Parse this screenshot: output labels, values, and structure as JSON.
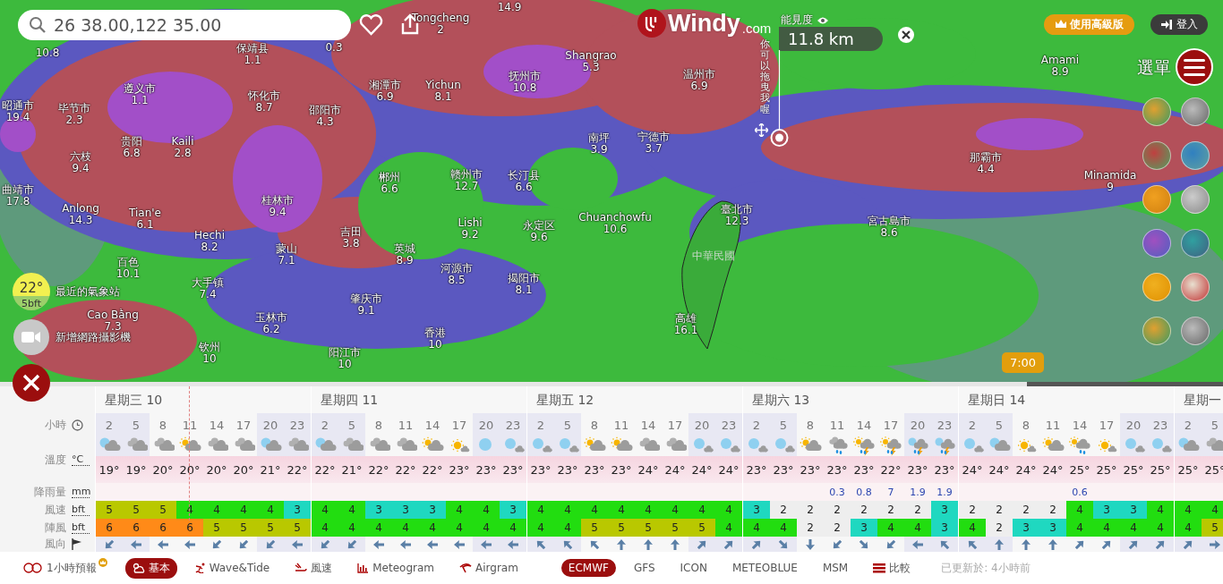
{
  "search": {
    "value": "26 38.00,122 35.00"
  },
  "logo": {
    "name": "Windy",
    "suffix": ".com"
  },
  "visibility": {
    "label": "能見度",
    "value": "11.8 km",
    "hint": "你可以拖曳我喔"
  },
  "premium_button": "使用高級版",
  "login_button": "登入",
  "menu_label": "選單",
  "station": {
    "temp": "22°",
    "wind": "5bft",
    "label": "最近的氣象站"
  },
  "webcam_label": "新增網路攝影機",
  "timeline": {
    "time": "7:00",
    "level": 0.84
  },
  "map_labels": [
    {
      "value": "10.8"
    },
    {
      "name": "保靖县",
      "value": "1.1"
    },
    {
      "value": "0.3"
    },
    {
      "name": "Tongcheng",
      "value": "2"
    },
    {
      "value": "14.9"
    },
    {
      "name": "遵义市",
      "value": "1.1"
    },
    {
      "name": "怀化市",
      "value": "8.7"
    },
    {
      "name": "湘潭市",
      "value": "6.9"
    },
    {
      "name": "Yichun",
      "value": "8.1"
    },
    {
      "name": "抚州市",
      "value": "10.8"
    },
    {
      "name": "Shangrao",
      "value": "5.3"
    },
    {
      "name": "温州市",
      "value": "6.9"
    },
    {
      "name": "昭通市",
      "value": "19.4"
    },
    {
      "name": "毕节市",
      "value": "2.3"
    },
    {
      "name": "邵阳市",
      "value": "4.3"
    },
    {
      "name": "贵阳",
      "value": "6.8"
    },
    {
      "name": "Kaili",
      "value": "2.8"
    },
    {
      "name": "六枝",
      "value": "9.4"
    },
    {
      "name": "南坪",
      "value": "3.9"
    },
    {
      "name": "宁德市",
      "value": "3.7"
    },
    {
      "name": "曲靖市",
      "value": "17.8"
    },
    {
      "name": "郴州",
      "value": "6.6"
    },
    {
      "name": "赣州市",
      "value": "12.7"
    },
    {
      "name": "长汀县",
      "value": "6.6"
    },
    {
      "name": "桂林市",
      "value": "9.4"
    },
    {
      "name": "Anlong",
      "value": "14.3"
    },
    {
      "name": "Tian'e",
      "value": "6.1"
    },
    {
      "name": "Lishi",
      "value": "9.2"
    },
    {
      "name": "永定区",
      "value": "9.6"
    },
    {
      "name": "Chuanchowfu",
      "value": "10.6"
    },
    {
      "name": "臺北市",
      "value": "12.3"
    },
    {
      "name": "宮古島市",
      "value": "8.6"
    },
    {
      "name": "那霸市",
      "value": "4.4"
    },
    {
      "name": "Amami",
      "value": "8.9"
    },
    {
      "name": "Minamida",
      "value": "9"
    },
    {
      "name": "Hechi",
      "value": "8.2"
    },
    {
      "name": "吉田",
      "value": "3.8"
    },
    {
      "name": "蒙山",
      "value": "7.1"
    },
    {
      "name": "英城",
      "value": "8.9"
    },
    {
      "name": "百色",
      "value": "10.1"
    },
    {
      "name": "河源市",
      "value": "8.5"
    },
    {
      "name": "揭阳市",
      "value": "8.1"
    },
    {
      "name": "大手镇",
      "value": "7.4"
    },
    {
      "name": "肇庆市",
      "value": "9.1"
    },
    {
      "name": "Cao Bằng",
      "value": "7.3"
    },
    {
      "name": "玉林市",
      "value": "6.2"
    },
    {
      "name": "香港",
      "value": "10"
    },
    {
      "name": "钦州",
      "value": "10"
    },
    {
      "name": "阳江市",
      "value": "10"
    },
    {
      "name": "高雄",
      "value": "16.1"
    },
    {
      "name": "中華民國",
      "kind": "country"
    }
  ],
  "forecast": {
    "row_labels": [
      {
        "label": "小時",
        "kind": "clock"
      },
      {
        "label": "溫度",
        "kind": "unit",
        "unit": "°C"
      },
      {
        "label": "降雨量",
        "kind": "unit",
        "unit": "mm"
      },
      {
        "label": "風速",
        "kind": "unit",
        "unit": "bft"
      },
      {
        "label": "陣風",
        "kind": "unit",
        "unit": "bft"
      },
      {
        "label": "風向",
        "kind": "flag"
      }
    ],
    "days": [
      {
        "label": "星期三 10",
        "hours": [
          {
            "hour": "2",
            "night": true,
            "kind": "night-cloudy",
            "temp": "19°",
            "wind": "5",
            "gust": "6",
            "arrow": {
              "kind": "SW"
            }
          },
          {
            "hour": "5",
            "night": true,
            "kind": "cloudy",
            "temp": "19°",
            "wind": "5",
            "gust": "6",
            "arrow": {
              "kind": "W"
            }
          },
          {
            "hour": "8",
            "night": false,
            "kind": "cloudy",
            "temp": "20°",
            "wind": "5",
            "gust": "6",
            "arrow": {
              "kind": "W"
            }
          },
          {
            "hour": "11",
            "night": false,
            "kind": "sun-cloudy",
            "temp": "20°",
            "wind": "4",
            "gust": "6",
            "arrow": {
              "kind": "W"
            }
          },
          {
            "hour": "14",
            "night": false,
            "kind": "cloudy",
            "temp": "20°",
            "wind": "4",
            "gust": "5",
            "arrow": {
              "kind": "SW"
            }
          },
          {
            "hour": "17",
            "night": false,
            "kind": "cloudy",
            "temp": "20°",
            "wind": "4",
            "gust": "5",
            "arrow": {
              "kind": "SW"
            }
          },
          {
            "hour": "20",
            "night": true,
            "kind": "night-cloudy",
            "temp": "21°",
            "wind": "4",
            "gust": "5",
            "arrow": {
              "kind": "SW"
            }
          },
          {
            "hour": "23",
            "night": true,
            "kind": "cloudy",
            "temp": "22°",
            "wind": "3",
            "gust": "5",
            "arrow": {
              "kind": "W"
            }
          }
        ]
      },
      {
        "label": "星期四 11",
        "hours": [
          {
            "hour": "2",
            "night": true,
            "kind": "night-cloudy",
            "temp": "22°",
            "wind": "4",
            "gust": "4",
            "arrow": {
              "kind": "SW"
            }
          },
          {
            "hour": "5",
            "night": true,
            "kind": "cloudy",
            "temp": "21°",
            "wind": "4",
            "gust": "4",
            "arrow": {
              "kind": "SW"
            }
          },
          {
            "hour": "8",
            "night": false,
            "kind": "cloudy",
            "temp": "22°",
            "wind": "3",
            "gust": "4",
            "arrow": {
              "kind": "W"
            }
          },
          {
            "hour": "11",
            "night": false,
            "kind": "cloudy",
            "temp": "22°",
            "wind": "3",
            "gust": "4",
            "arrow": {
              "kind": "W"
            }
          },
          {
            "hour": "14",
            "night": false,
            "kind": "sun-cloudy",
            "temp": "22°",
            "wind": "3",
            "gust": "4",
            "arrow": {
              "kind": "W"
            }
          },
          {
            "hour": "17",
            "night": false,
            "kind": "sunny",
            "temp": "23°",
            "wind": "4",
            "gust": "4",
            "arrow": {
              "kind": "W"
            }
          },
          {
            "hour": "20",
            "night": true,
            "kind": "night-clear",
            "temp": "23°",
            "wind": "4",
            "gust": "4",
            "arrow": {
              "kind": "W"
            }
          },
          {
            "hour": "23",
            "night": true,
            "kind": "night-partly",
            "temp": "23°",
            "wind": "3",
            "gust": "4",
            "arrow": {
              "kind": "W"
            }
          }
        ]
      },
      {
        "label": "星期五 12",
        "hours": [
          {
            "hour": "2",
            "night": true,
            "kind": "night-partly",
            "temp": "23°",
            "wind": "4",
            "gust": "4",
            "arrow": {
              "kind": "NW"
            }
          },
          {
            "hour": "5",
            "night": true,
            "kind": "night-partly",
            "temp": "23°",
            "wind": "4",
            "gust": "4",
            "arrow": {
              "kind": "NW"
            }
          },
          {
            "hour": "8",
            "night": false,
            "kind": "sun-cloudy",
            "temp": "23°",
            "wind": "4",
            "gust": "5",
            "arrow": {
              "kind": "NW"
            }
          },
          {
            "hour": "11",
            "night": false,
            "kind": "sun-cloudy",
            "temp": "23°",
            "wind": "4",
            "gust": "5",
            "arrow": {
              "kind": "N"
            }
          },
          {
            "hour": "14",
            "night": false,
            "kind": "cloudy",
            "temp": "24°",
            "wind": "4",
            "gust": "5",
            "arrow": {
              "kind": "N"
            }
          },
          {
            "hour": "17",
            "night": false,
            "kind": "cloudy",
            "temp": "24°",
            "wind": "4",
            "gust": "5",
            "arrow": {
              "kind": "N"
            }
          },
          {
            "hour": "20",
            "night": true,
            "kind": "night-partly",
            "temp": "24°",
            "wind": "4",
            "gust": "5",
            "arrow": {
              "kind": "NE"
            }
          },
          {
            "hour": "23",
            "night": true,
            "kind": "night-partly",
            "temp": "24°",
            "wind": "4",
            "gust": "4",
            "arrow": {
              "kind": "NE"
            }
          }
        ]
      },
      {
        "label": "星期六 13",
        "hours": [
          {
            "hour": "2",
            "night": true,
            "kind": "night-partly",
            "temp": "23°",
            "wind": "3",
            "gust": "4",
            "arrow": {
              "kind": "NE"
            }
          },
          {
            "hour": "5",
            "night": true,
            "kind": "night-partly",
            "temp": "23°",
            "wind": "2",
            "gust": "4",
            "arrow": {
              "kind": "SE"
            }
          },
          {
            "hour": "8",
            "night": false,
            "kind": "sun-cloudy",
            "temp": "23°",
            "wind": "2",
            "gust": "2",
            "arrow": {
              "kind": "S"
            }
          },
          {
            "hour": "11",
            "night": false,
            "kind": "cloudy-rain",
            "temp": "23°",
            "rain": "0.3",
            "wind": "2",
            "gust": "2",
            "arrow": {
              "kind": "SW"
            }
          },
          {
            "hour": "14",
            "night": false,
            "kind": "sun-thunder",
            "temp": "23°",
            "rain": "0.8",
            "wind": "2",
            "gust": "3",
            "arrow": {
              "kind": "SE"
            }
          },
          {
            "hour": "17",
            "night": false,
            "kind": "sun-thunder",
            "temp": "22°",
            "rain": "7",
            "wind": "2",
            "gust": "4",
            "arrow": {
              "kind": "SW"
            }
          },
          {
            "hour": "20",
            "night": true,
            "kind": "night-thunder",
            "temp": "23°",
            "rain": "1.9",
            "wind": "2",
            "gust": "4",
            "arrow": {
              "kind": "W"
            }
          },
          {
            "hour": "23",
            "night": true,
            "kind": "night-thunder",
            "temp": "23°",
            "rain": "1.9",
            "wind": "3",
            "gust": "3",
            "arrow": {
              "kind": "NW"
            }
          }
        ]
      },
      {
        "label": "星期日 14",
        "hours": [
          {
            "hour": "2",
            "night": true,
            "kind": "night-partly",
            "temp": "24°",
            "wind": "2",
            "gust": "4",
            "arrow": {
              "kind": "NW"
            }
          },
          {
            "hour": "5",
            "night": true,
            "kind": "night-cloudy",
            "temp": "24°",
            "wind": "2",
            "gust": "2",
            "arrow": {
              "kind": "N"
            }
          },
          {
            "hour": "8",
            "night": false,
            "kind": "sunny",
            "temp": "24°",
            "wind": "2",
            "gust": "3",
            "arrow": {
              "kind": "N"
            }
          },
          {
            "hour": "11",
            "night": false,
            "kind": "sun-cloudy",
            "temp": "24°",
            "wind": "2",
            "gust": "3",
            "arrow": {
              "kind": "N"
            }
          },
          {
            "hour": "14",
            "night": false,
            "kind": "sun-rain",
            "temp": "25°",
            "rain": "0.6",
            "wind": "4",
            "gust": "4",
            "arrow": {
              "kind": "NE"
            }
          },
          {
            "hour": "17",
            "night": false,
            "kind": "sunny",
            "temp": "25°",
            "wind": "3",
            "gust": "4",
            "arrow": {
              "kind": "NE"
            }
          },
          {
            "hour": "20",
            "night": true,
            "kind": "night-partly",
            "temp": "25°",
            "wind": "3",
            "gust": "4",
            "arrow": {
              "kind": "NE"
            }
          },
          {
            "hour": "23",
            "night": true,
            "kind": "night-partly",
            "temp": "25°",
            "wind": "4",
            "gust": "4",
            "arrow": {
              "kind": "NE"
            }
          }
        ]
      },
      {
        "label": "星期一",
        "hours": [
          {
            "hour": "2",
            "night": true,
            "kind": "night-cloudy",
            "temp": "25°",
            "wind": "4",
            "gust": "4",
            "arrow": {
              "kind": "NE"
            }
          },
          {
            "hour": "5",
            "night": true,
            "kind": "cloudy",
            "temp": "25°",
            "wind": "4",
            "gust": "5",
            "arrow": {
              "kind": "E"
            }
          }
        ]
      }
    ]
  },
  "view_tabs": [
    {
      "label": "1小時預報",
      "kind": "toggle",
      "selected": false
    },
    {
      "label": "基本",
      "kind": "basic",
      "selected": true
    },
    {
      "label": "Wave&Tide",
      "kind": "wave",
      "selected": false
    },
    {
      "label": "風速",
      "kind": "wind",
      "selected": false
    },
    {
      "label": "Meteogram",
      "kind": "meteogram",
      "selected": false
    },
    {
      "label": "Airgram",
      "kind": "airgram",
      "selected": false
    }
  ],
  "model_tabs": [
    {
      "label": "ECMWF",
      "selected": true
    },
    {
      "label": "GFS",
      "selected": false
    },
    {
      "label": "ICON",
      "selected": false
    },
    {
      "label": "METEOBLUE",
      "selected": false
    },
    {
      "label": "MSM",
      "selected": false
    },
    {
      "label": "比較",
      "kind": "compare",
      "selected": false
    }
  ],
  "updated": "已更新於: 4小時前"
}
